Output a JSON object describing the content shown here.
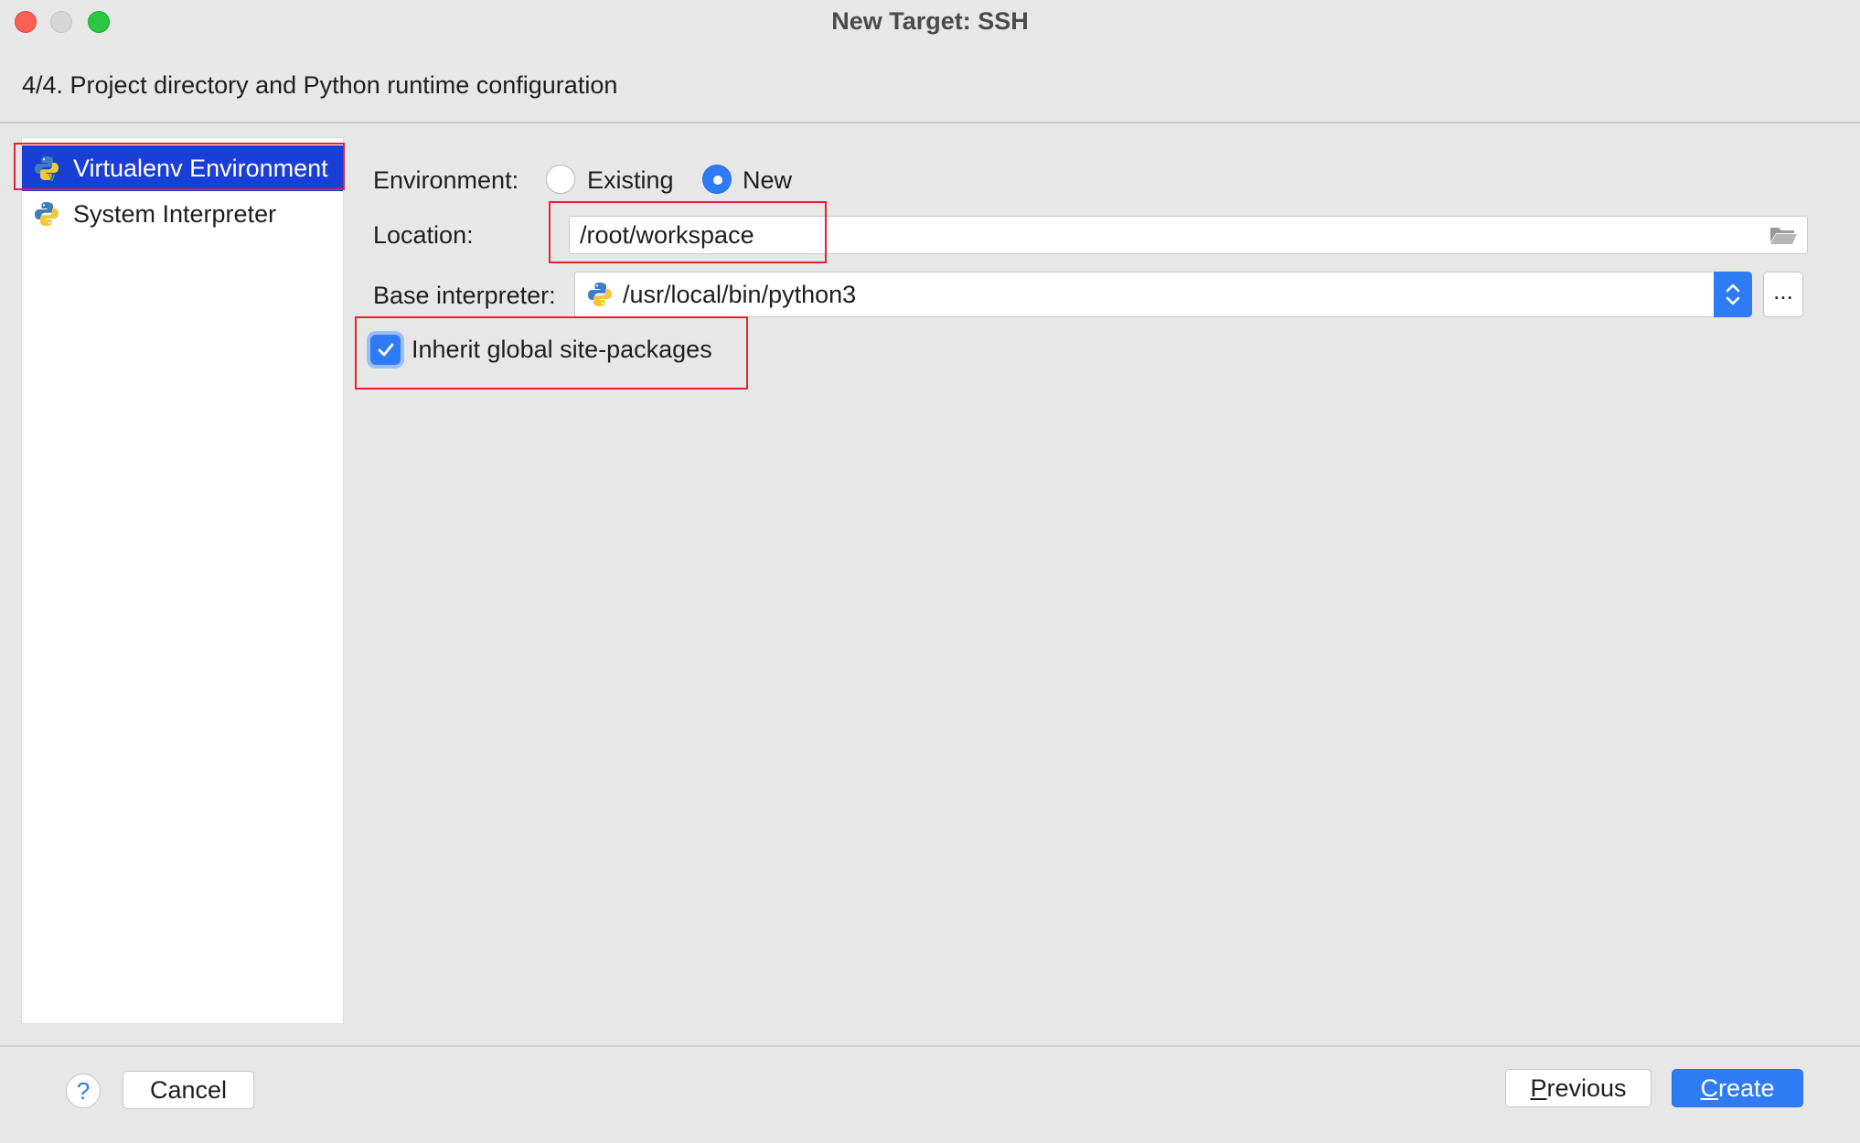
{
  "window": {
    "title": "New Target: SSH"
  },
  "header": {
    "step_title": "4/4. Project directory and Python runtime configuration"
  },
  "sidebar": {
    "items": [
      {
        "label": "Virtualenv Environment",
        "icon": "python-virtualenv-icon",
        "selected": true
      },
      {
        "label": "System Interpreter",
        "icon": "python-icon",
        "selected": false
      }
    ]
  },
  "form": {
    "environment_label": "Environment:",
    "environment_options": [
      {
        "label": "Existing",
        "checked": false
      },
      {
        "label": "New",
        "checked": true
      }
    ],
    "location_label": "Location:",
    "location_value": "/root/workspace",
    "base_interpreter_label": "Base interpreter:",
    "base_interpreter_value": "/usr/local/bin/python3",
    "more_button_label": "...",
    "inherit_label": "Inherit global site-packages",
    "inherit_checked": true
  },
  "footer": {
    "help_label": "?",
    "cancel_label": "Cancel",
    "previous_label": "Previous",
    "create_label": "Create"
  },
  "colors": {
    "accent": "#2f7bf5",
    "selection": "#1a3fd6",
    "highlight_box": "#e5232f"
  }
}
